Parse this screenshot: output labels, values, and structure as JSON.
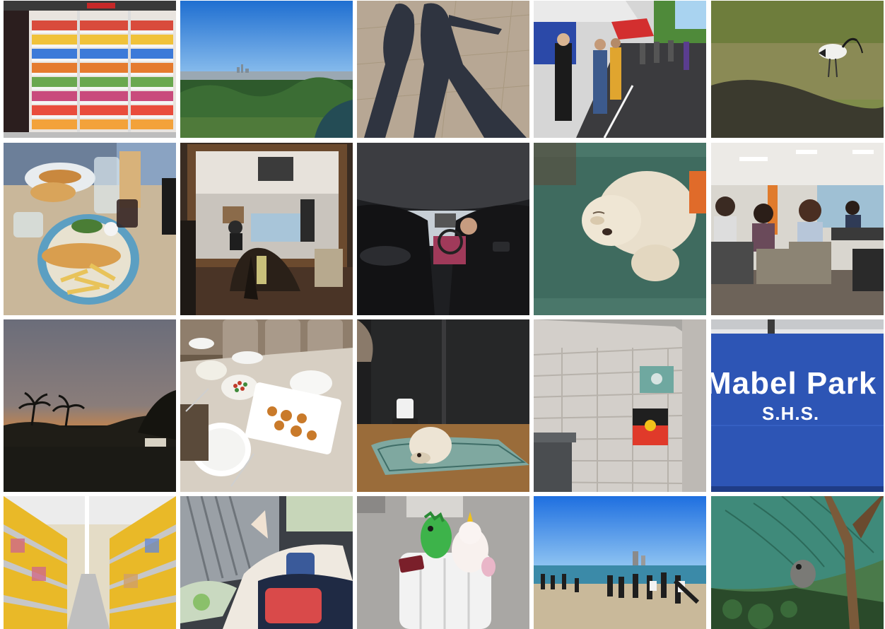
{
  "gallery": {
    "photos": [
      {
        "id": "snack-aisle",
        "kind": "photo"
      },
      {
        "id": "city-skyline",
        "kind": "photo"
      },
      {
        "id": "shadows",
        "kind": "photo"
      },
      {
        "id": "street-market",
        "kind": "photo"
      },
      {
        "id": "ibis-grass",
        "kind": "photo"
      },
      {
        "id": "fish-and-chips",
        "kind": "photo"
      },
      {
        "id": "mirror-interior",
        "kind": "photo"
      },
      {
        "id": "car-interior",
        "kind": "photo"
      },
      {
        "id": "fluffy-dog",
        "kind": "photo"
      },
      {
        "id": "classroom",
        "kind": "photo"
      },
      {
        "id": "sunset-palms",
        "kind": "photo"
      },
      {
        "id": "dinner-table",
        "kind": "photo"
      },
      {
        "id": "dog-on-rug",
        "kind": "photo"
      },
      {
        "id": "flags-on-wall",
        "kind": "photo"
      },
      {
        "id": "school-sign",
        "kind": "photo"
      },
      {
        "id": "shop-aisle",
        "kind": "photo"
      },
      {
        "id": "travelers-snacks",
        "kind": "photo"
      },
      {
        "id": "suitcase-plushies",
        "kind": "photo"
      },
      {
        "id": "beach-group",
        "kind": "photo"
      },
      {
        "id": "koala-tree",
        "kind": "photo"
      }
    ],
    "sign": {
      "line1": "Mabel Park",
      "line2": "S.H.S."
    }
  }
}
